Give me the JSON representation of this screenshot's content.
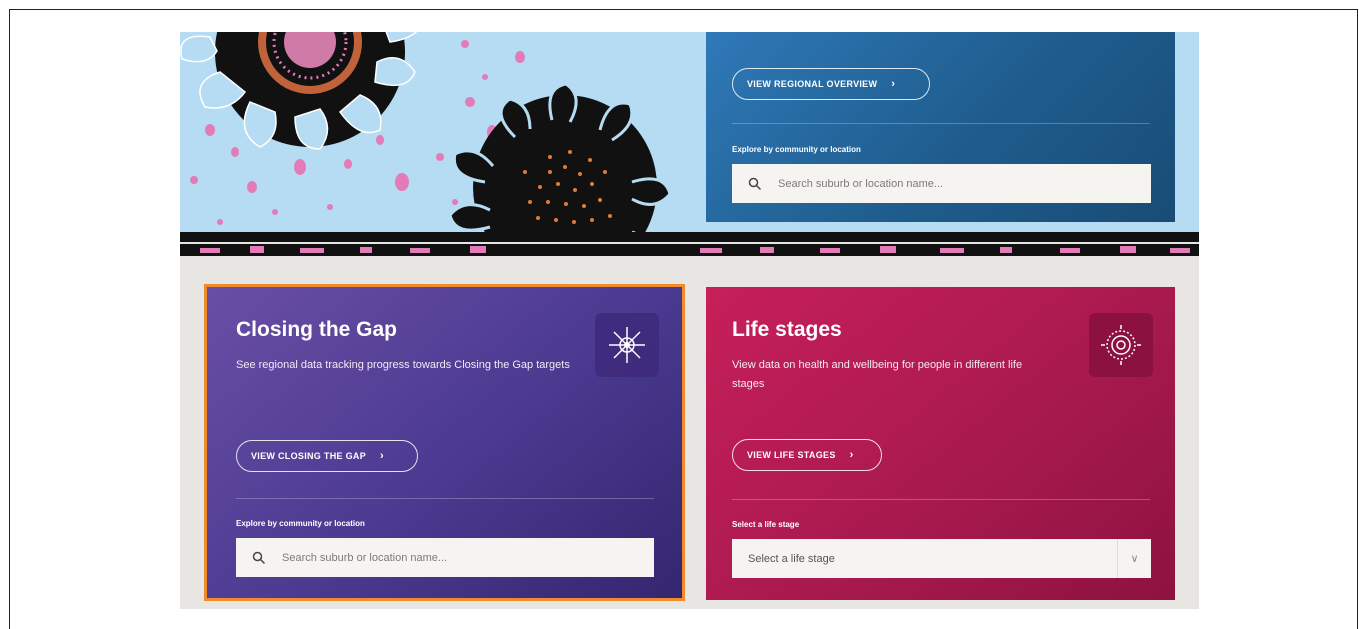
{
  "regional": {
    "button_label": "VIEW REGIONAL OVERVIEW",
    "explore_label": "Explore by community or location",
    "search_placeholder": "Search suburb or location name..."
  },
  "closing_gap": {
    "title": "Closing the Gap",
    "description": "See regional data tracking progress towards Closing the Gap targets",
    "button_label": "VIEW CLOSING THE GAP",
    "explore_label": "Explore by community or location",
    "search_placeholder": "Search suburb or location name..."
  },
  "life_stages": {
    "title": "Life stages",
    "description": "View data on health and wellbeing for people in different life stages",
    "button_label": "VIEW LIFE STAGES",
    "select_label": "Select a life stage",
    "select_value": "Select a life stage"
  },
  "colors": {
    "hero_bg": "#b5dcf2",
    "blue_card": "#1f5d8e",
    "purple_card": "#4a3a90",
    "pink_card": "#a91a4e",
    "highlight_border": "#f08a2c"
  }
}
